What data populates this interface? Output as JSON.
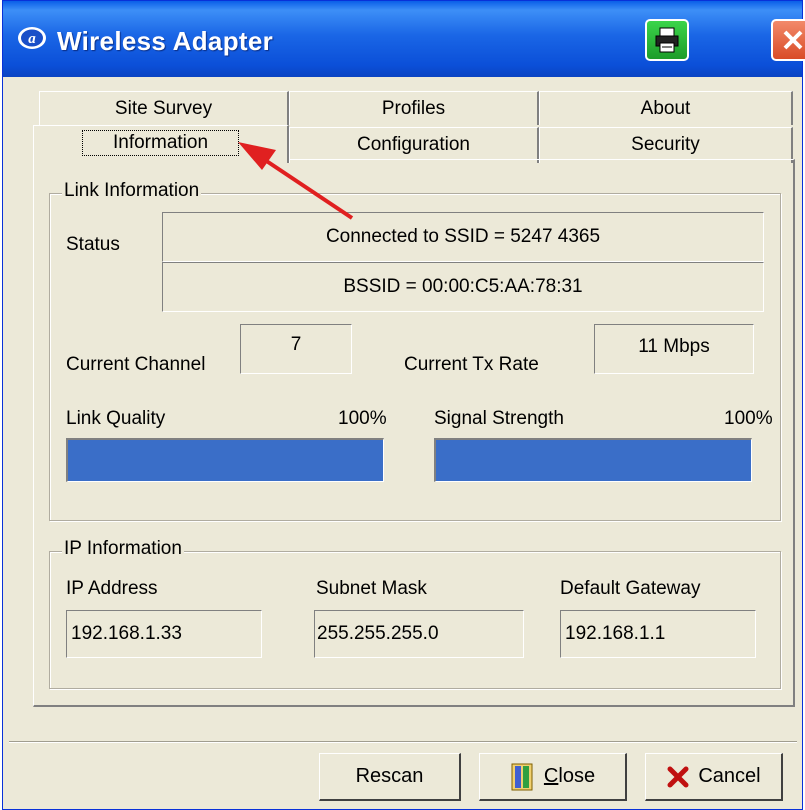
{
  "window": {
    "title": "Wireless Adapter",
    "accent_color": "#0a5ee8",
    "icons": {
      "app": "adapter-logo-icon",
      "printer": "printer-icon",
      "close": "close-x-icon"
    }
  },
  "tabs": {
    "back_row": [
      "Site Survey",
      "Profiles",
      "About"
    ],
    "front_row": [
      "Information",
      "Configuration",
      "Security"
    ],
    "selected": "Information"
  },
  "link_info": {
    "group_label": "Link Information",
    "status_label": "Status",
    "status_value": "Connected to SSID = 5247 4365",
    "bssid_value": "BSSID = 00:00:C5:AA:78:31",
    "channel_label": "Current Channel",
    "channel_value": "7",
    "tx_rate_label": "Current Tx Rate",
    "tx_rate_value": "11 Mbps",
    "link_quality_label": "Link Quality",
    "link_quality_value": "100%",
    "link_quality_fraction": 1.0,
    "signal_strength_label": "Signal Strength",
    "signal_strength_value": "100%",
    "signal_strength_fraction": 1.0,
    "bar_color": "#3a6ec8"
  },
  "ip_info": {
    "group_label": "IP Information",
    "ip_label": "IP Address",
    "ip_value": "192.168.1.33",
    "subnet_label": "Subnet Mask",
    "subnet_value": "255.255.255.0",
    "gateway_label": "Default Gateway",
    "gateway_value": "192.168.1.1"
  },
  "buttons": {
    "rescan": "Rescan",
    "close_rest": "lose",
    "close_mnemonic": "C",
    "cancel": "Cancel"
  },
  "annotation": {
    "arrow_color": "#e02020"
  }
}
